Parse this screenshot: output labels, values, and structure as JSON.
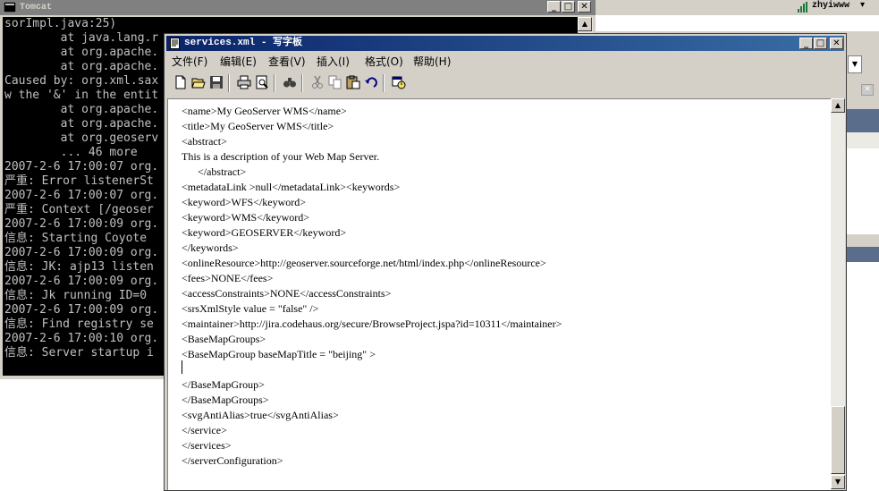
{
  "tomcat": {
    "title": "Tomcat",
    "console_lines": [
      "sorImpl.java:25)",
      "        at java.lang.r",
      "        at org.apache.",
      "        at org.apache.",
      "Caused by: org.xml.sax",
      "w the '&' in the entit",
      "        at org.apache.",
      "        at org.apache.",
      "        at org.geoserv",
      "        ... 46 more",
      "2007-2-6 17:00:07 org.",
      "严重: Error listenerSt",
      "2007-2-6 17:00:07 org.",
      "严重: Context [/geoser",
      "2007-2-6 17:00:09 org.",
      "信息: Starting Coyote",
      "2007-2-6 17:00:09 org.",
      "信息: JK: ajp13 listen",
      "2007-2-6 17:00:09 org.",
      "信息: Jk running ID=0",
      "2007-2-6 17:00:09 org.",
      "信息: Find registry se",
      "2007-2-6 17:00:10 org.",
      "信息: Server startup i"
    ]
  },
  "taskbar": {
    "user": "zhyiwww",
    "arrow": "▾"
  },
  "wordpad": {
    "title": "services.xml - 写字板",
    "menus": [
      "文件(F)",
      "编辑(E)",
      "查看(V)",
      "插入(I)",
      "格式(O)",
      "帮助(H)"
    ],
    "toolbar_icons": [
      "new-document-icon",
      "open-folder-icon",
      "save-icon",
      "print-icon",
      "print-preview-icon",
      "find-icon",
      "cut-icon",
      "copy-icon",
      "paste-icon",
      "undo-icon",
      "insert-datetime-icon"
    ],
    "lines": [
      "<name>My GeoServer WMS</name>",
      "<title>My GeoServer WMS</title>",
      "<abstract>",
      "This is a description of your Web Map Server.",
      "      </abstract>",
      "<metadataLink >null</metadataLink><keywords>",
      "<keyword>WFS</keyword>",
      "<keyword>WMS</keyword>",
      "<keyword>GEOSERVER</keyword>",
      "</keywords>",
      "<onlineResource>http://geoserver.sourceforge.net/html/index.php</onlineResource>",
      "<fees>NONE</fees>",
      "<accessConstraints>NONE</accessConstraints>",
      "<srsXmlStyle value = \"false\" />",
      "<maintainer>http://jira.codehaus.org/secure/BrowseProject.jspa?id=10311</maintainer>",
      "<BaseMapGroups>",
      "<BaseMapGroup baseMapTitle = \"beijing\" >",
      "",
      "</BaseMapGroup>",
      "</BaseMapGroups>",
      "<svgAntiAlias>true</svgAntiAlias>",
      "</service>",
      "</services>",
      "</serverConfiguration>"
    ]
  }
}
